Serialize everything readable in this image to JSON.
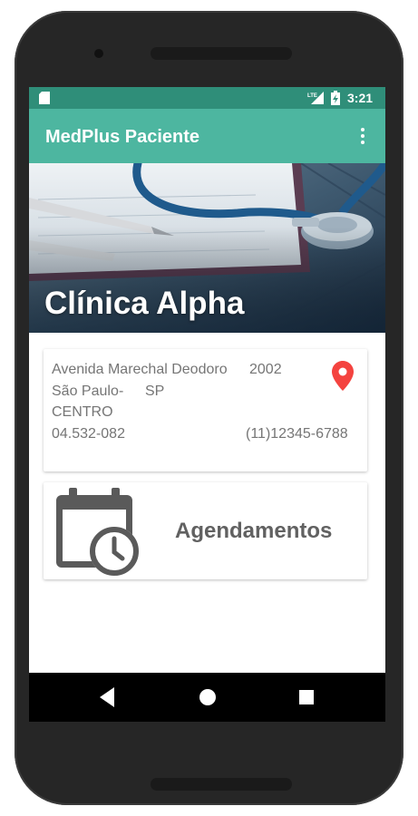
{
  "status_bar": {
    "time": "3:21",
    "network_label": "LTE",
    "icons": [
      "sd-card-icon",
      "lte-signal-icon",
      "battery-charging-icon"
    ]
  },
  "app_bar": {
    "title": "MedPlus Paciente",
    "overflow_icon": "more-vert-icon"
  },
  "hero": {
    "clinic_name": "Clínica Alpha"
  },
  "address_card": {
    "street": "Avenida Marechal Deodoro",
    "number": "2002",
    "city": "São Paulo",
    "separator": "-",
    "state": "SP",
    "district": "CENTRO",
    "zip": "04.532-082",
    "phone": "(11)12345-6788",
    "pin_color": "#f4433f"
  },
  "appointments": {
    "label": "Agendamentos"
  },
  "nav_bar": {
    "icons": [
      "back-icon",
      "home-icon",
      "recents-icon"
    ]
  },
  "colors": {
    "status_bar": "#2f8e79",
    "app_bar": "#4db6a0",
    "text_secondary": "#757575",
    "card_label": "#616161"
  }
}
